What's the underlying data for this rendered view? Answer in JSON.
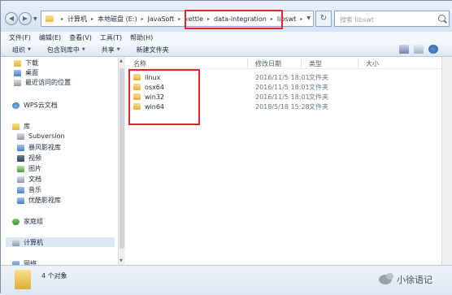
{
  "address": {
    "crumbs": [
      "计算机",
      "本地磁盘 (E:)",
      "JavaSoft",
      "kettle",
      "data-integration",
      "libswt"
    ],
    "search_placeholder": "搜索 libswt"
  },
  "menu": [
    "文件(F)",
    "编辑(E)",
    "查看(V)",
    "工具(T)",
    "帮助(H)"
  ],
  "toolbar": {
    "organize": "组织",
    "include_in_library": "包含到库中",
    "share": "共享",
    "new_folder": "新建文件夹"
  },
  "nav": {
    "favorites": [
      "下载",
      "桌面",
      "最近访问的位置"
    ],
    "wps": "WPS云文档",
    "library": "库",
    "library_items": [
      "Subversion",
      "暴风影视库",
      "视频",
      "图片",
      "文档",
      "音乐",
      "优酷影视库"
    ],
    "homegroup": "家庭组",
    "computer": "计算机",
    "network": "网络"
  },
  "columns": {
    "name": "名称",
    "modified": "修改日期",
    "type": "类型",
    "size": "大小"
  },
  "files": [
    {
      "name": "linux",
      "modified": "2016/11/5 18:01",
      "type": "文件夹"
    },
    {
      "name": "osx64",
      "modified": "2016/11/5 18:01",
      "type": "文件夹"
    },
    {
      "name": "win32",
      "modified": "2016/11/5 18:01",
      "type": "文件夹"
    },
    {
      "name": "win64",
      "modified": "2018/5/18 15:28",
      "type": "文件夹"
    }
  ],
  "status": {
    "count": "4 个对象"
  },
  "watermark": "小徐语记",
  "colors": {
    "highlight_border": "#e0262b",
    "folder": "#e8bd46",
    "selection": "#dbe7f4"
  }
}
